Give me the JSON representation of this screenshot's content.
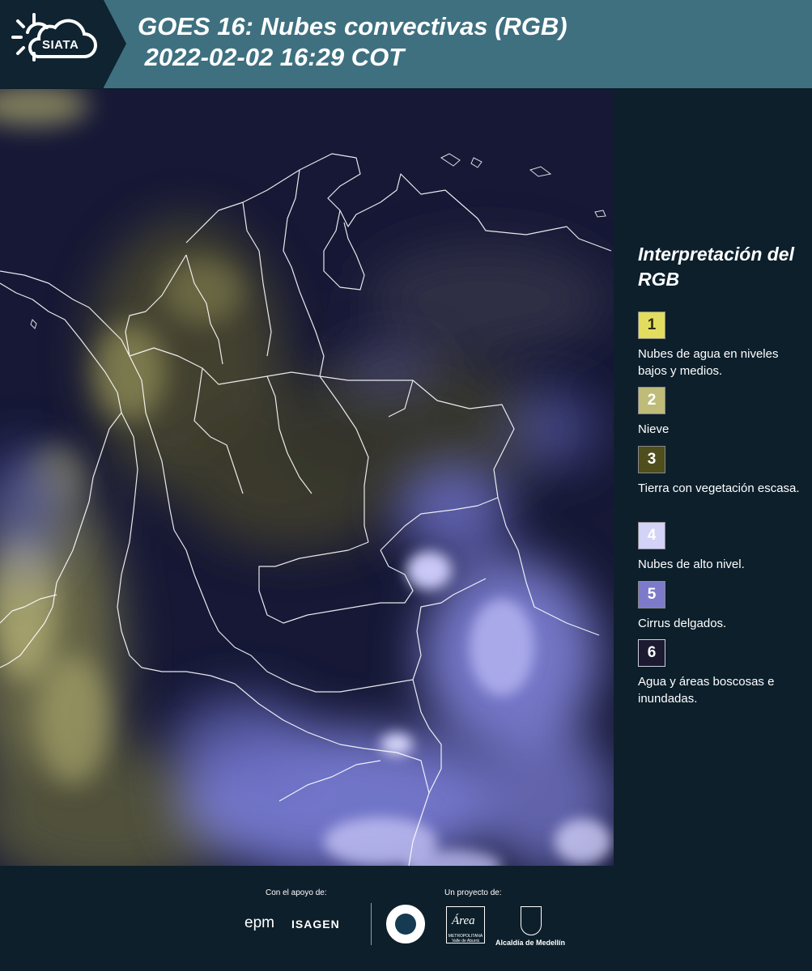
{
  "header": {
    "logo_text": "SIATA",
    "title_line1": "GOES 16: Nubes convectivas (RGB)",
    "title_line2": " 2022-02-02 16:29 COT"
  },
  "legend": {
    "title": "Interpretación del RGB",
    "items": [
      {
        "number": "1",
        "label": "Nubes de agua en niveles bajos y medios.",
        "color": "#e2dd5f",
        "text_color": "#2d2c0a"
      },
      {
        "number": "2",
        "label": "Nieve",
        "color": "#bfbb79",
        "text_color": "#ffffff"
      },
      {
        "number": "3",
        "label": "Tierra con vegetación escasa.",
        "color": "#4f4e1d",
        "text_color": "#ffffff"
      },
      {
        "number": "4",
        "label": "Nubes de alto nivel.",
        "color": "#d3d2f7",
        "text_color": "#ffffff"
      },
      {
        "number": "5",
        "label": "Cirrus delgados.",
        "color": "#7d7bc9",
        "text_color": "#ffffff"
      },
      {
        "number": "6",
        "label": "Agua y áreas boscosas e inundadas.",
        "color": "#1b1a30",
        "text_color": "#ffffff"
      }
    ]
  },
  "footer": {
    "support_label": "Con el apoyo de:",
    "project_label": "Un proyecto de:",
    "epm_label": "epm",
    "isagen_label": "ISAGEN",
    "area_label": "Área",
    "area_sub_label": "METROPOLITANA Valle de Aburrá",
    "alcaldia_label": "Alcaldía de Medellín"
  },
  "colors": {
    "header_bg": "#3e7080",
    "logo_bg": "#0f2330",
    "legend_bg": "#0c1f2b",
    "map_dark": "#151735",
    "cloud_blue": "#8d8ef0"
  }
}
